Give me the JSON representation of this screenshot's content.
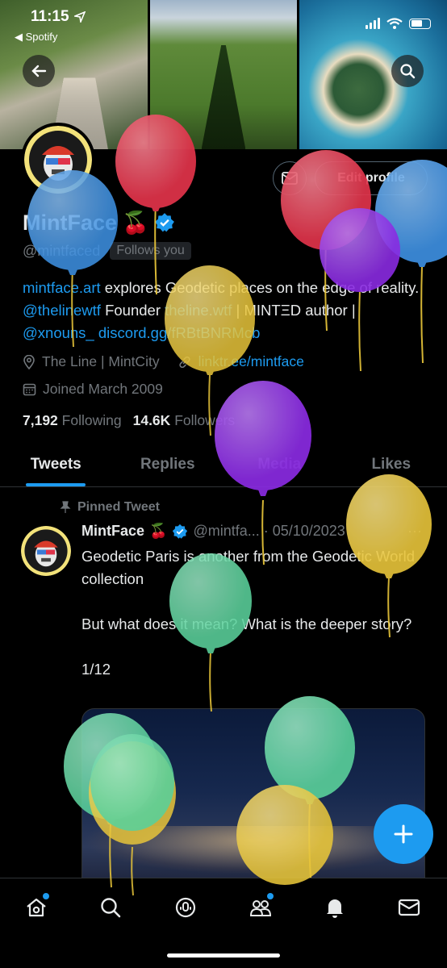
{
  "status_bar": {
    "time": "11:15",
    "back_app": "◀ Spotify"
  },
  "profile": {
    "name": "MintFace",
    "name_emoji": "🍒",
    "handle": "@mintfaced",
    "follows_you": "Follows you",
    "edit_profile": "Edit profile",
    "bio_link1": "mintface.art",
    "bio_text1": " explores Geodetic places on the edge of reality. ",
    "bio_link2": "@thelinewtf",
    "bio_text2": " Founder ",
    "bio_link3": "theline.wtf",
    "bio_text3": " | MINTΞD author | ",
    "bio_link4": "@xnouns_",
    "bio_text4": " ",
    "bio_link5": "discord.gg/fRBtBNRMcb",
    "location": "The Line | MintCity",
    "website": "linktr.ee/mintface",
    "joined": "Joined March 2009",
    "following_count": "7,192",
    "following_label": "Following",
    "followers_count": "14.6K",
    "followers_label": "Followers"
  },
  "tabs": [
    {
      "label": "Tweets",
      "active": true
    },
    {
      "label": "Replies",
      "active": false
    },
    {
      "label": "Media",
      "active": false
    },
    {
      "label": "Likes",
      "active": false
    }
  ],
  "tweet": {
    "pinned_label": "Pinned Tweet",
    "author": "MintFace",
    "author_emoji": "🍒",
    "meta": "@mintfa... · 05/10/2023",
    "more": "···",
    "text": "Geodetic Paris is another from the Geodetic World collection\n\nBut what does it mean? What is the deeper story?\n\n1/12"
  },
  "fab": {
    "icon": "plus-icon"
  },
  "bottom_nav": [
    "home-icon",
    "search-icon",
    "spaces-icon",
    "communities-icon",
    "notifications-icon",
    "messages-icon"
  ],
  "colors": {
    "accent": "#1d9bf0",
    "background": "#000000",
    "muted": "#71767b",
    "balloon_red": "#e0334a",
    "balloon_blue": "#3d8fe0",
    "balloon_purple": "#8a2be2",
    "balloon_yellow": "#e8c53a",
    "balloon_green": "#5ad19b"
  }
}
